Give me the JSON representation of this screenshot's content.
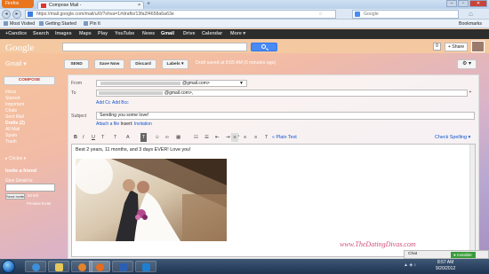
{
  "browser": {
    "menu_label": "Firefox",
    "tab_title": "Compose Mail - ",
    "tab_close": "×",
    "new_tab": "+",
    "url": "https://mail.google.com/mail/u/0/?shva=1#drafts/13fa2f4658a6a63e",
    "search_placeholder": "Google",
    "window_controls": [
      "–",
      "▫",
      "✕"
    ]
  },
  "bookmarks": {
    "items": [
      "Most Visited",
      "Getting Started",
      "Pin It"
    ],
    "right": "Bookmarks"
  },
  "google_bar": {
    "items": [
      "+Candice",
      "Search",
      "Images",
      "Maps",
      "Play",
      "YouTube",
      "News",
      "Gmail",
      "Drive",
      "Calendar",
      "More ▾"
    ],
    "active": "Gmail"
  },
  "header": {
    "logo": "Google",
    "notifications": "0",
    "share_label": "+ Share"
  },
  "actions": {
    "gmail_label": "Gmail ▾",
    "send": "SEND",
    "save_now": "Save Now",
    "discard": "Discard",
    "labels": "Labels ▾",
    "draft_status": "Draft saved at 8:55 AM (0 minutes ago)",
    "settings": "⚙ ▾"
  },
  "sidebar": {
    "compose": "COMPOSE",
    "items": [
      "Inbox",
      "Starred",
      "Important",
      "Chats",
      "Sent Mail",
      "Drafts (2)",
      "All Mail",
      "Spam",
      "Trash"
    ],
    "circles": "▸ Circles ▾",
    "invite_title": "Invite a friend",
    "invite_sub": "Give Gmail to:",
    "invite_button": "Send Invite",
    "invites_left": "50 left",
    "preview_invite": "Preview Invite"
  },
  "compose": {
    "from_label": "From",
    "from_value": "@gmail.com>",
    "to_label": "To",
    "to_value": "@gmail.com>,",
    "add_cc": "Add Cc",
    "add_bcc": "Add Bcc",
    "subject_label": "Subject",
    "subject_value": "Sending you some love!",
    "attach_file": "Attach a file",
    "insert_label": "Insert:",
    "invitation": "Invitation",
    "plain_text": "« Plain Text",
    "check_spelling": "Check Spelling ▾",
    "body_text": "Best 2 years, 11 months, and 3 days EVER! Love you!"
  },
  "toolbar": [
    "B",
    "I",
    "U",
    "T",
    "T",
    "A",
    "T",
    "☺",
    "∞",
    "▦",
    "☷",
    "☰",
    "⇤",
    "⇥",
    "❝",
    "≡",
    "≡",
    "≡",
    "T"
  ],
  "watermark": "www.TheDatingDivas.com",
  "chat": {
    "label": "Chat",
    "status": "● Invisible"
  },
  "taskbar": {
    "time": "8:57 AM",
    "date": "9/20/2012"
  }
}
